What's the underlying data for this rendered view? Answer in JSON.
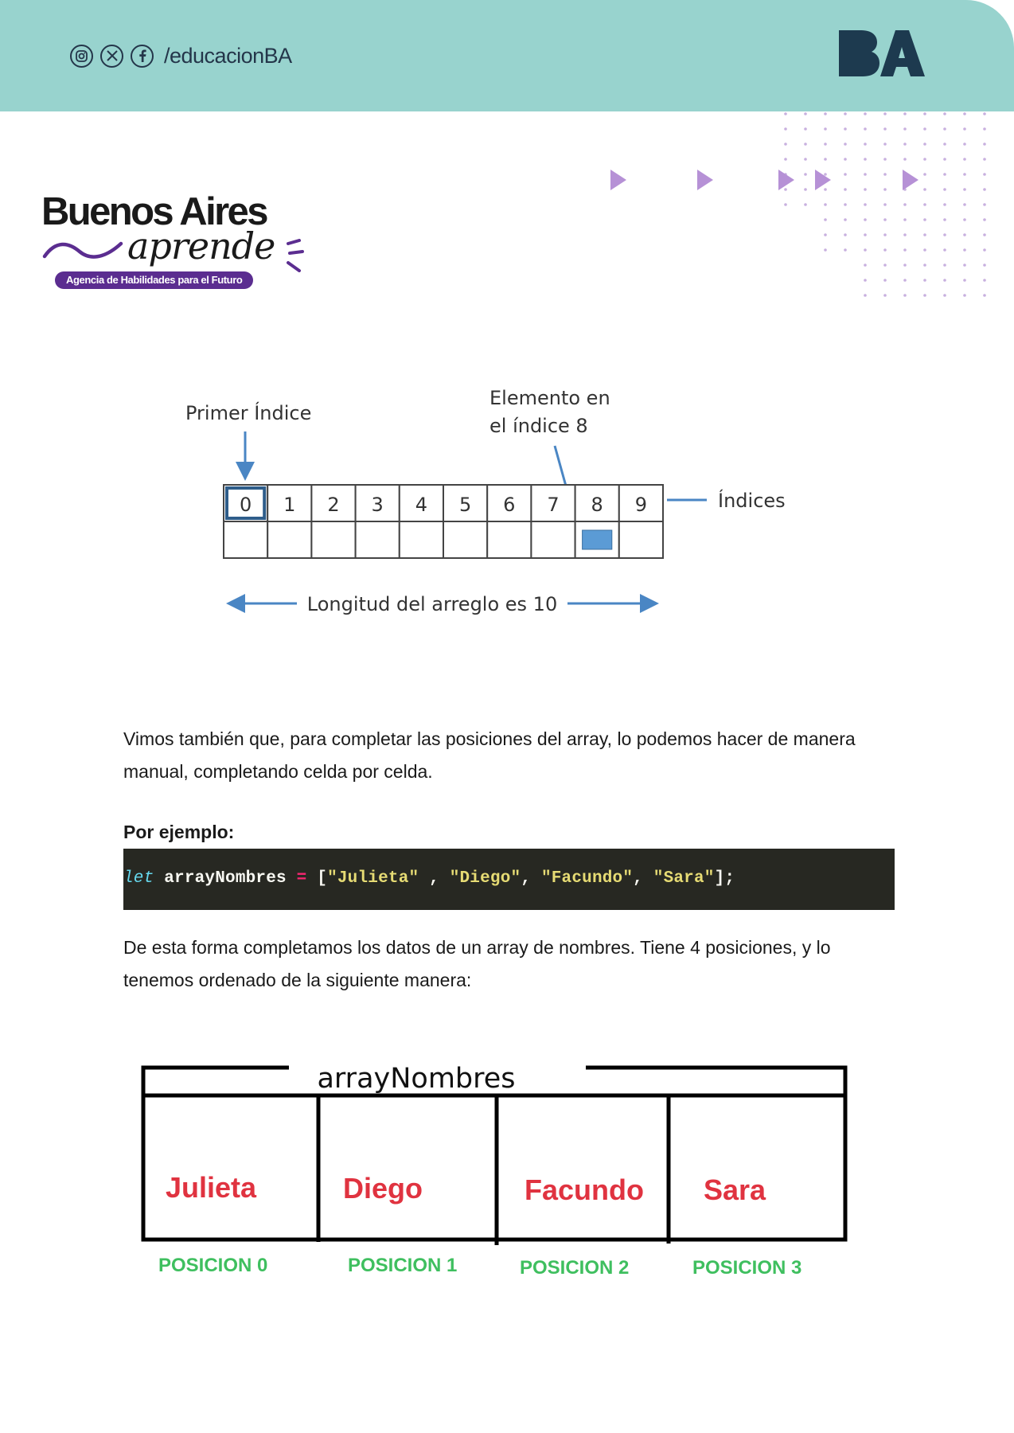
{
  "header": {
    "handle": "/educacionBA",
    "social_icons": [
      "instagram-icon",
      "x-icon",
      "facebook-icon"
    ],
    "brand": "BA",
    "brand_color": "#1d3a4f",
    "band_color": "#98d3ce"
  },
  "logo": {
    "title": "Buenos Aires",
    "script": "aprende",
    "tagline": "Agencia de Habilidades para el Futuro",
    "accent": "#5b2d90"
  },
  "array_diagram": {
    "first_index_label": "Primer Índice",
    "element_label_line1": "Elemento en",
    "element_label_line2": "el índice 8",
    "indices_label": "Índices",
    "indices": [
      "0",
      "1",
      "2",
      "3",
      "4",
      "5",
      "6",
      "7",
      "8",
      "9"
    ],
    "highlighted_index": 8,
    "length_label": "Longitud del arreglo es 10"
  },
  "paragraph1": "Vimos también que, para completar las posiciones del array, lo podemos hacer de manera manual, completando celda por celda.",
  "example_label": "Por ejemplo:",
  "code": {
    "keyword": "let",
    "variable": "arrayNombres",
    "operator": "=",
    "values": [
      "\"Julieta\"",
      "\"Diego\"",
      "\"Facundo\"",
      "\"Sara\""
    ]
  },
  "paragraph2": "De esta forma completamos los datos de un array de nombres. Tiene 4 posiciones, y lo tenemos ordenado de la siguiente manera:",
  "names_diagram": {
    "title": "arrayNombres",
    "names": [
      "Julieta",
      "Diego",
      "Facundo",
      "Sara"
    ],
    "positions": [
      "POSICION 0",
      "POSICION 1",
      "POSICION 2",
      "POSICION 3"
    ],
    "name_color": "#e03340",
    "position_color": "#3fbf5f"
  }
}
